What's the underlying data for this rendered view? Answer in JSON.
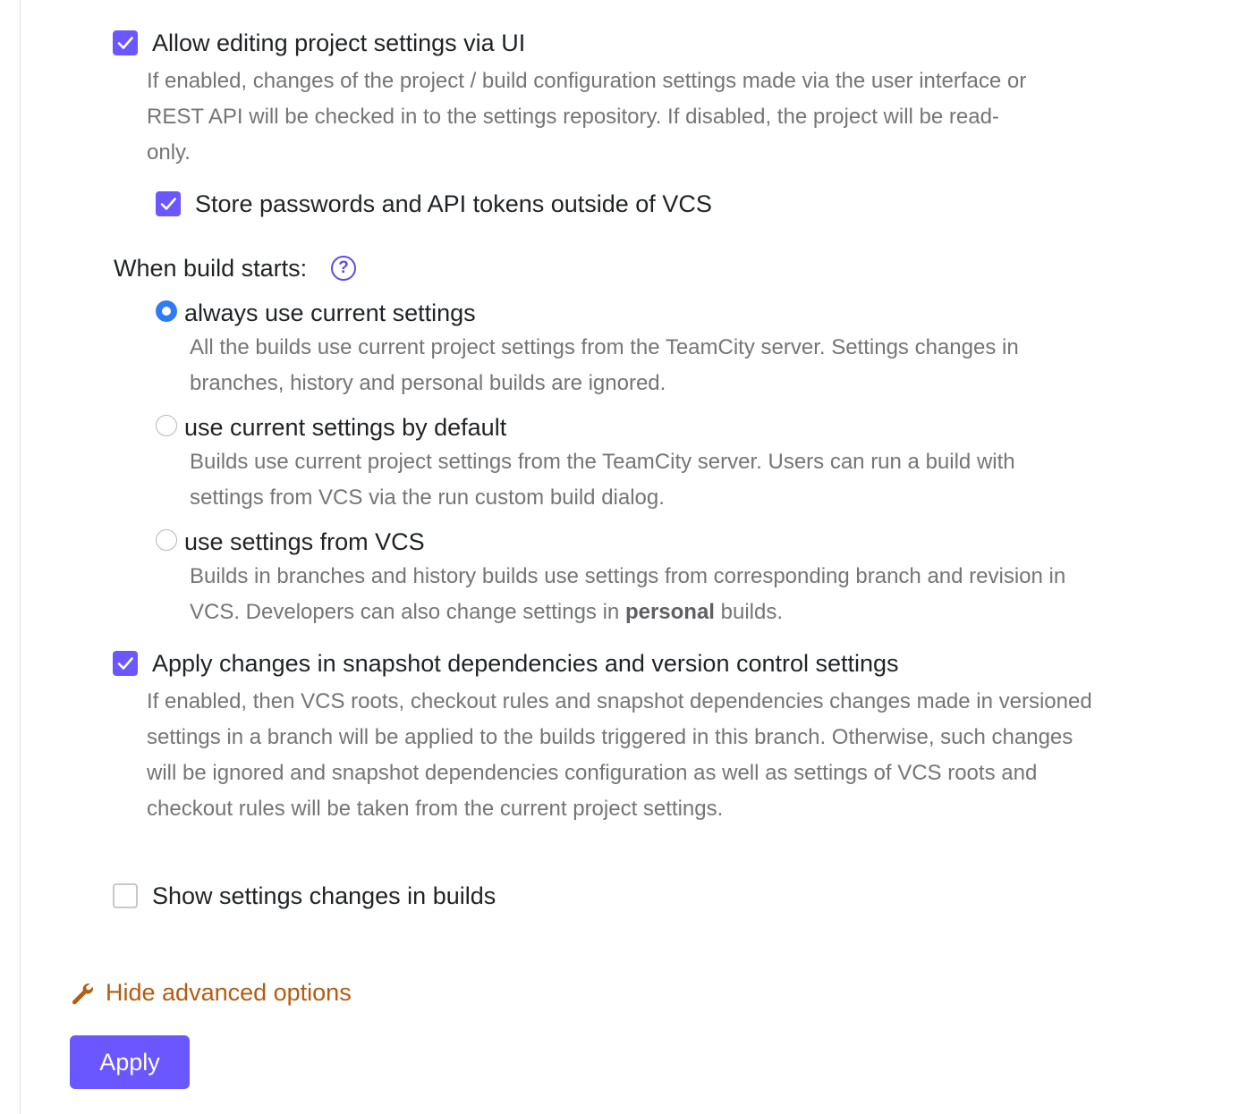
{
  "options": {
    "allow_editing": {
      "label": "Allow editing project settings via UI",
      "checked": true,
      "description": "If enabled, changes of the project / build configuration settings made via the user interface or REST API will be checked in to the settings repository. If disabled, the project will be read-only."
    },
    "store_passwords": {
      "label": "Store passwords and API tokens outside of VCS",
      "checked": true
    },
    "when_build_starts": {
      "label": "When build starts:",
      "help_icon": "question-circle-icon",
      "selected": "always use current settings",
      "choices": [
        {
          "label": "always use current settings",
          "description": "All the builds use current project settings from the TeamCity server. Settings changes in branches, history and personal builds are ignored."
        },
        {
          "label": "use current settings by default",
          "description": "Builds use current project settings from the TeamCity server. Users can run a build with settings from VCS via the run custom build dialog."
        },
        {
          "label": "use settings from VCS",
          "description_before": "Builds in branches and history builds use settings from corresponding branch and revision in VCS. Developers can also change settings in ",
          "description_bold": "personal",
          "description_after": " builds."
        }
      ]
    },
    "apply_changes": {
      "label": "Apply changes in snapshot dependencies and version control settings",
      "checked": true,
      "description": "If enabled, then VCS roots, checkout rules and snapshot dependencies changes made in versioned settings in a branch will be applied to the builds triggered in this branch. Otherwise, such changes will be ignored and snapshot dependencies configuration as well as settings of VCS roots and checkout rules will be taken from the current project settings."
    },
    "show_changes": {
      "label": "Show settings changes in builds",
      "checked": false
    }
  },
  "advanced_link": {
    "icon": "wrench-icon",
    "label": "Hide advanced options"
  },
  "apply_button": {
    "label": "Apply"
  },
  "colors": {
    "accent": "#6b57ff",
    "radio_selected": "#2f7bf5",
    "link": "#b35c12",
    "description_text": "#737577"
  }
}
